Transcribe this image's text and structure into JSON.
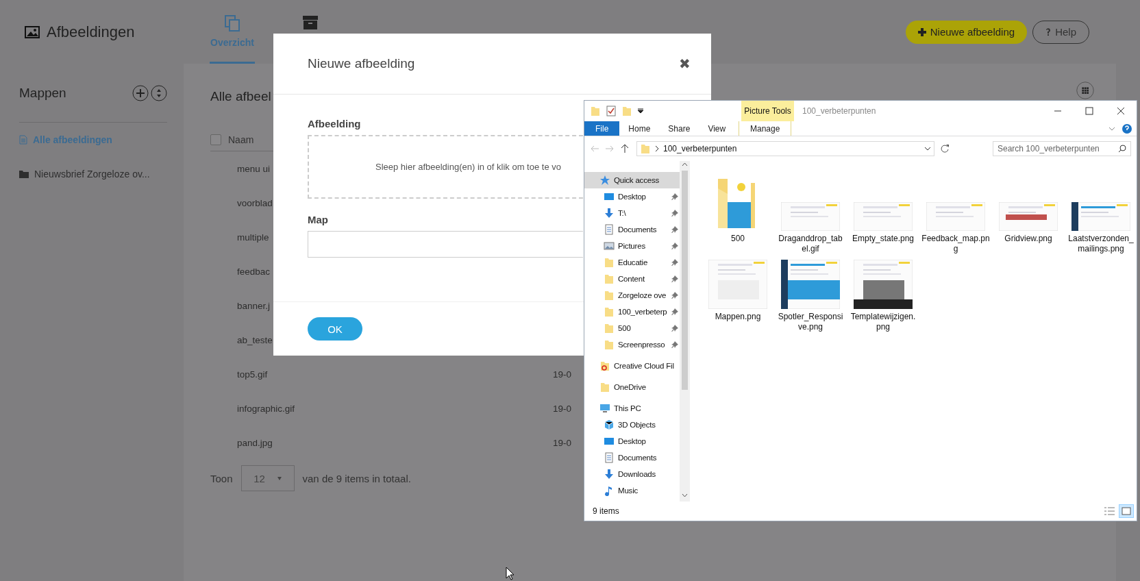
{
  "app": {
    "title": "Afbeeldingen",
    "tabs": [
      {
        "label": "Overzicht",
        "selected": true
      },
      {
        "selected": false
      }
    ],
    "actions": {
      "new": "Nieuwe afbeelding",
      "help": "Help"
    }
  },
  "sidebar": {
    "title": "Mappen",
    "items": [
      {
        "label": "Alle afbeeldingen",
        "kind": "all",
        "selected": true
      },
      {
        "label": "Nieuwsbrief Zorgeloze ov...",
        "kind": "folder",
        "selected": false
      }
    ]
  },
  "content": {
    "title": "Alle afbeel",
    "select_all": {
      "checked": false
    },
    "columns": [
      "Naam"
    ],
    "rows": [
      {
        "name": "menu ui"
      },
      {
        "name": "voorblad"
      },
      {
        "name": "multiple"
      },
      {
        "name": "feedbac"
      },
      {
        "name": "banner.j"
      },
      {
        "name": "ab_teste"
      },
      {
        "name": "top5.gif",
        "date": "19-0"
      },
      {
        "name": "infographic.gif",
        "date": "19-0"
      },
      {
        "name": "pand.jpg",
        "date": "19-0"
      }
    ],
    "footer": {
      "label": "Toon",
      "page_size": "12",
      "summary": "van de 9 items in totaal."
    }
  },
  "dialog": {
    "title": "Nieuwe afbeelding",
    "close": "✖",
    "image_label": "Afbeelding",
    "dropzone": "Sleep hier afbeelding(en) in of klik om toe te vo",
    "map_label": "Map",
    "ok": "OK"
  },
  "explorer": {
    "title": "100_verbeterpunten",
    "context_group": "Picture Tools",
    "ribbon_tabs": [
      {
        "label": "File",
        "kind": "file"
      },
      {
        "label": "Home",
        "kind": "plain"
      },
      {
        "label": "Share",
        "kind": "plain"
      },
      {
        "label": "View",
        "kind": "plain"
      },
      {
        "label": "Manage",
        "kind": "context"
      }
    ],
    "address": "100_verbeterpunten",
    "search": {
      "placeholder": "Search 100_verbeterpunten"
    },
    "nav": [
      {
        "label": "Quick access",
        "kind": "star",
        "selected": true,
        "children": [
          {
            "label": "Desktop",
            "kind": "desktop",
            "pinned": true
          },
          {
            "label": "T:\\",
            "kind": "download",
            "pinned": true
          },
          {
            "label": "Documents",
            "kind": "documents",
            "pinned": true
          },
          {
            "label": "Pictures",
            "kind": "pictures",
            "pinned": true
          },
          {
            "label": "Educatie",
            "kind": "folder",
            "pinned": true
          },
          {
            "label": "Content",
            "kind": "folder",
            "pinned": true
          },
          {
            "label": "Zorgeloze ove",
            "kind": "folder",
            "pinned": true
          },
          {
            "label": "100_verbeterp",
            "kind": "folder",
            "pinned": true
          },
          {
            "label": "500",
            "kind": "folder",
            "pinned": true
          },
          {
            "label": "Screenpresso",
            "kind": "folder",
            "pinned": true
          }
        ]
      },
      {
        "label": "Creative Cloud Fil",
        "kind": "cloud",
        "selected": false
      },
      {
        "label": "OneDrive",
        "kind": "folder",
        "selected": false
      },
      {
        "label": "This PC",
        "kind": "pc",
        "selected": false,
        "children": [
          {
            "label": "3D Objects",
            "kind": "cube",
            "pinned": false
          },
          {
            "label": "Desktop",
            "kind": "desktop",
            "pinned": false
          },
          {
            "label": "Documents",
            "kind": "documents",
            "pinned": false
          },
          {
            "label": "Downloads",
            "kind": "download",
            "pinned": false
          },
          {
            "label": "Music",
            "kind": "music",
            "pinned": false
          }
        ]
      }
    ],
    "files": [
      {
        "name": "500",
        "kind": "folder"
      },
      {
        "name": "Draganddrop_tabel.gif",
        "kind": "picture"
      },
      {
        "name": "Empty_state.png",
        "kind": "picture"
      },
      {
        "name": "Feedback_map.png",
        "kind": "picture"
      },
      {
        "name": "Gridview.png",
        "kind": "picture"
      },
      {
        "name": "Laatstverzonden_mailings.png",
        "kind": "picture"
      },
      {
        "name": "Mappen.png",
        "kind": "picture"
      },
      {
        "name": "Spotler_Responsive.png",
        "kind": "picture"
      },
      {
        "name": "Templatewijzigen.png",
        "kind": "picture"
      }
    ],
    "status": "9 items"
  }
}
